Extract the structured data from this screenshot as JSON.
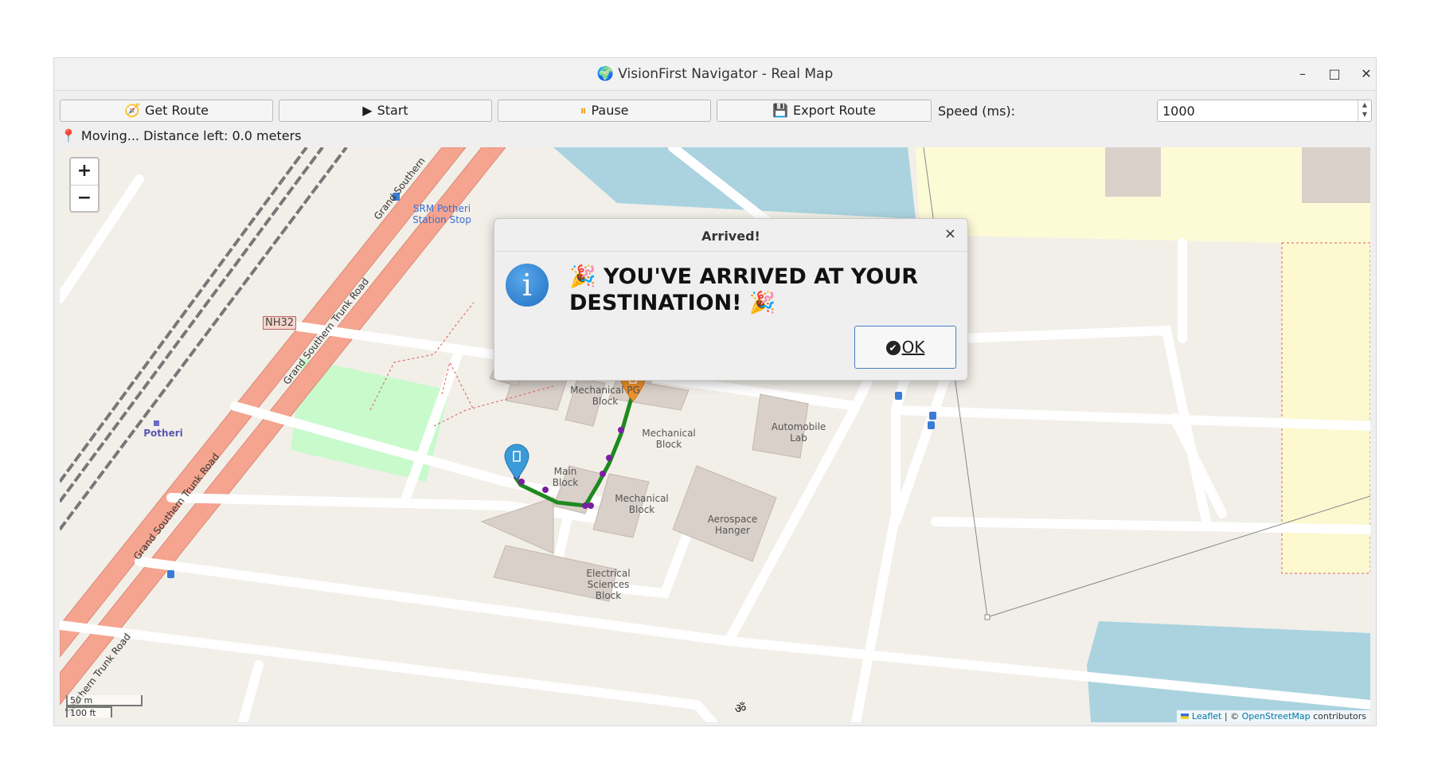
{
  "window": {
    "title": "🌍 VisionFirst Navigator - Real Map",
    "minimize_icon": "minimize-icon",
    "maximize_icon": "maximize-icon",
    "close_icon": "close-icon"
  },
  "toolbar": {
    "get_route": {
      "icon": "🧭",
      "label": "Get Route"
    },
    "start": {
      "icon": "▶",
      "label": "Start"
    },
    "pause": {
      "icon": "⏸",
      "label": "Pause"
    },
    "export": {
      "icon": "💾",
      "label": "Export Route"
    },
    "speed_label": "Speed (ms):",
    "speed_value": "1000"
  },
  "status": {
    "icon": "📍",
    "text": "Moving... Distance left: 0.0 meters"
  },
  "map": {
    "zoom_in": "+",
    "zoom_out": "−",
    "labels": {
      "srm_stop": "SRM Potheri Station Stop",
      "potheri": "Potheri",
      "mech_pg": "Mechanical PG Block",
      "mech_block": "Mechanical Block",
      "main_block": "Main Block",
      "mech_block2": "Mechanical Block",
      "aerospace": "Aerospace Hanger",
      "electrical": "Electrical Sciences Block",
      "auto_lab": "Automobile Lab",
      "block_partial": "Block",
      "nh32": "NH32",
      "gst1": "Grand Southern",
      "gst2": "Grand Southern Trunk Road",
      "gst3": "Grand Southern Trunk Road",
      "gst4": "Southern Trunk Road",
      "om": "ॐ"
    },
    "scale": {
      "metric": "50 m",
      "imperial": "100 ft"
    },
    "attribution": {
      "leaflet": "Leaflet",
      "sep": " | © ",
      "osm": "OpenStreetMap",
      "tail": " contributors"
    },
    "colors": {
      "route": "#1e8a1e",
      "waypoint": "#7a1fa2",
      "start_marker": "#3a9bd9",
      "end_marker": "#f0922a",
      "water": "#aad3df",
      "trunk": "#f5a48f"
    }
  },
  "dialog": {
    "title": "Arrived!",
    "close": "×",
    "message": "🎉 YOU'VE ARRIVED AT YOUR DESTINATION! 🎉",
    "ok_label": "OK",
    "icon": "info-icon"
  }
}
